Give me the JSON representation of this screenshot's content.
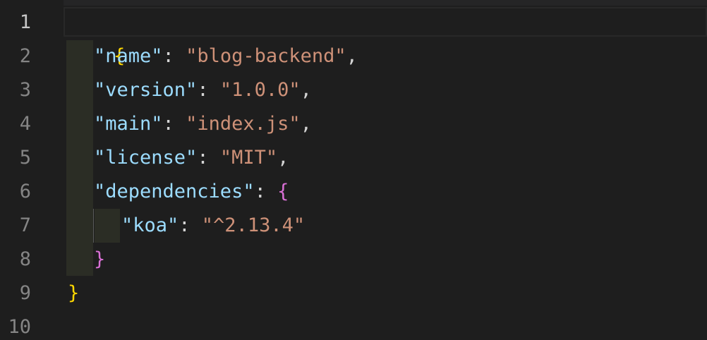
{
  "line_numbers": [
    "1",
    "2",
    "3",
    "4",
    "5",
    "6",
    "7",
    "8",
    "9",
    "10"
  ],
  "code": {
    "open_brace": "{",
    "close_brace": "}",
    "name": {
      "key": "\"name\"",
      "sep": ": ",
      "value": "\"blog-backend\"",
      "comma": ","
    },
    "version": {
      "key": "\"version\"",
      "sep": ": ",
      "value": "\"1.0.0\"",
      "comma": ","
    },
    "main": {
      "key": "\"main\"",
      "sep": ": ",
      "value": "\"index.js\"",
      "comma": ","
    },
    "license": {
      "key": "\"license\"",
      "sep": ": ",
      "value": "\"MIT\"",
      "comma": ","
    },
    "dependencies": {
      "key": "\"dependencies\"",
      "sep": ": ",
      "open": "{",
      "close": "}"
    },
    "koa": {
      "key": "\"koa\"",
      "sep": ": ",
      "value": "\"^2.13.4\""
    }
  },
  "colors": {
    "background": "#1e1e1e",
    "key": "#9cdcfe",
    "string": "#ce9178",
    "brace_level_1": "#ffd700",
    "brace_level_2": "#da70d6",
    "line_number": "#858585"
  }
}
